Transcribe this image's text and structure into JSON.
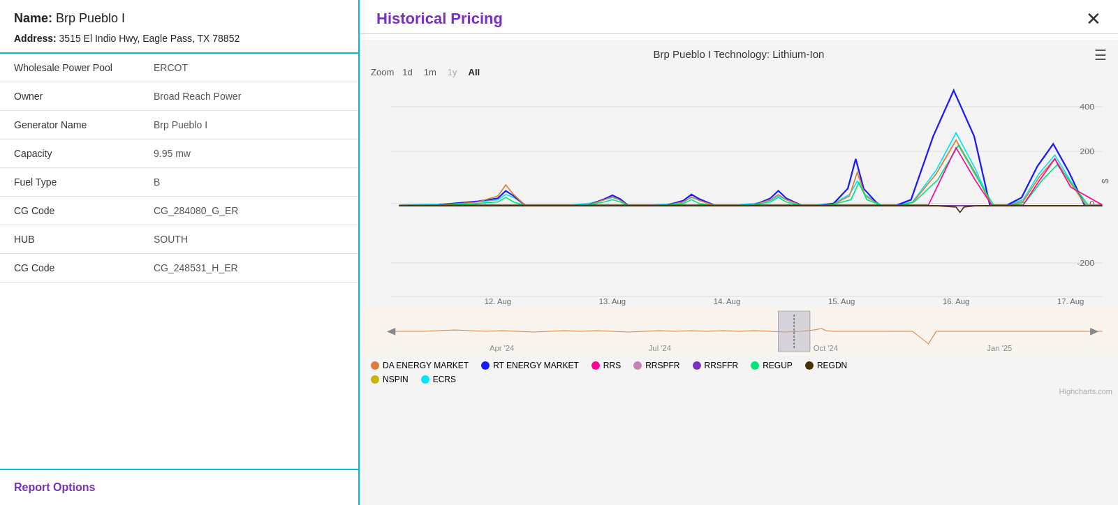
{
  "left": {
    "name_label": "Name:",
    "name_value": "Brp Pueblo I",
    "address_label": "Address:",
    "address_value": "3515 El Indio Hwy, Eagle Pass, TX 78852",
    "fields": [
      {
        "label": "Wholesale Power Pool",
        "value": "ERCOT"
      },
      {
        "label": "Owner",
        "value": "Broad Reach Power"
      },
      {
        "label": "Generator Name",
        "value": "Brp Pueblo I"
      },
      {
        "label": "Capacity",
        "value": "9.95 mw"
      },
      {
        "label": "Fuel Type",
        "value": "B"
      },
      {
        "label": "CG Code",
        "value": "CG_284080_G_ER"
      },
      {
        "label": "HUB",
        "value": "SOUTH"
      },
      {
        "label": "CG Code",
        "value": "CG_248531_H_ER"
      }
    ],
    "report_options_label": "Report Options"
  },
  "right": {
    "title": "Historical Pricing",
    "close_label": "✕",
    "chart_title": "Brp Pueblo I Technology: Lithium-Ion",
    "hamburger": "☰",
    "zoom_label": "Zoom",
    "zoom_options": [
      "1d",
      "1m",
      "1y",
      "All"
    ],
    "zoom_active": "All",
    "y_axis_labels": [
      "400",
      "200",
      "0",
      "-200"
    ],
    "y_axis_unit": "$",
    "x_axis_labels": [
      "12. Aug",
      "13. Aug",
      "14. Aug",
      "15. Aug",
      "16. Aug",
      "17. Aug"
    ],
    "navigator_labels": [
      "Apr '24",
      "Jul '24",
      "Oct '24",
      "Jan '25"
    ],
    "legend": [
      {
        "label": "DA ENERGY MARKET",
        "color": "#e07b39"
      },
      {
        "label": "RT ENERGY MARKET",
        "color": "#1a1aff"
      },
      {
        "label": "RRS",
        "color": "#ff0099"
      },
      {
        "label": "RRSPFR",
        "color": "#c97fb8"
      },
      {
        "label": "RRSFFR",
        "color": "#7b2fbe"
      },
      {
        "label": "REGUP",
        "color": "#00e676"
      },
      {
        "label": "REGDN",
        "color": "#4a3000"
      },
      {
        "label": "NSPIN",
        "color": "#c8b400"
      },
      {
        "label": "ECRS",
        "color": "#00e5ff"
      }
    ],
    "highcharts_credit": "Highcharts.com"
  }
}
